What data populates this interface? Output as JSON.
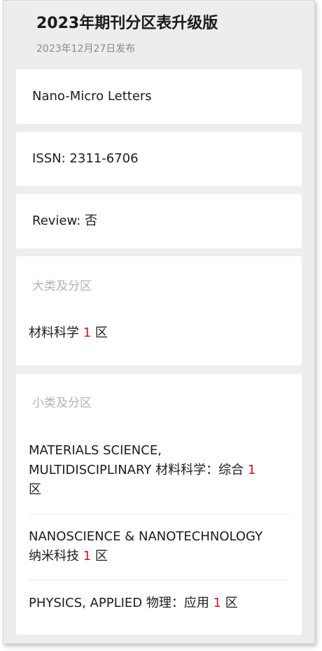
{
  "header": {
    "title": "2023年期刊分区表升级版",
    "date": "2023年12月27日发布"
  },
  "journal": {
    "name": "Nano-Micro Letters",
    "issn": "ISSN: 2311-6706",
    "review": "Review: 否"
  },
  "major_category": {
    "label": "大类及分区",
    "entry": {
      "name": "材料科学",
      "zone_num": "1",
      "zone_suffix": "区"
    }
  },
  "minor_category": {
    "label": "小类及分区",
    "entries": [
      {
        "line1": "MATERIALS SCIENCE,",
        "line2_prefix": "MULTIDISCIPLINARY 材料科学：综合",
        "zone_num": "1",
        "zone_suffix": "区"
      },
      {
        "line1": "NANOSCIENCE & NANOTECHNOLOGY",
        "line2_prefix": "纳米科技",
        "zone_num": "1",
        "zone_suffix": "区"
      },
      {
        "line1": "PHYSICS, APPLIED 物理：应用",
        "zone_num": "1",
        "zone_suffix": "区"
      }
    ]
  },
  "colors": {
    "zone_number": "#d0161b",
    "page_bg": "#ededed",
    "card_bg": "#ffffff",
    "muted_text": "#b3b3b3"
  }
}
